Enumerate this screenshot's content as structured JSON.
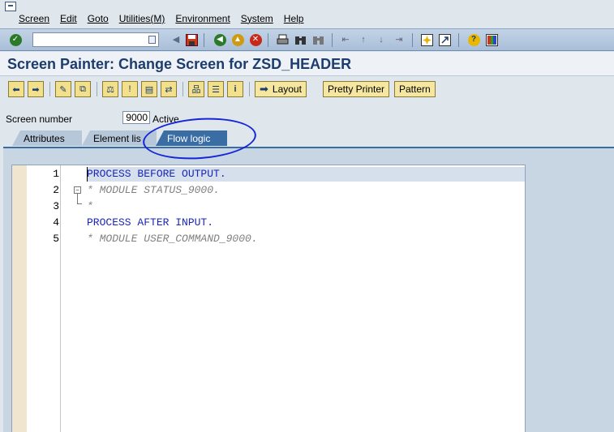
{
  "menubar": {
    "items": [
      "Screen",
      "Edit",
      "Goto",
      "Utilities(M)",
      "Environment",
      "System",
      "Help"
    ]
  },
  "stdbar": {
    "command_value": ""
  },
  "title": "Screen Painter: Change Screen for ZSD_HEADER",
  "apptoolbar": {
    "layout_label": "Layout",
    "pretty_printer_label": "Pretty Printer",
    "pattern_label": "Pattern"
  },
  "screen": {
    "label": "Screen number",
    "number": "9000",
    "status": "Active"
  },
  "tabs": [
    {
      "label": "Attributes"
    },
    {
      "label": "Element lis"
    },
    {
      "label": "Flow logic"
    }
  ],
  "editor": {
    "line_numbers": [
      "1",
      "2",
      "3",
      "4",
      "5"
    ],
    "lines": [
      "PROCESS BEFORE OUTPUT.",
      "* MODULE STATUS_9000.",
      "*",
      "PROCESS AFTER INPUT.",
      "* MODULE USER_COMMAND_9000."
    ]
  },
  "colors": {
    "keyword": "#1a26b8",
    "comment": "#808080",
    "title": "#1d3c6e",
    "active_tab": "#3a6da4",
    "annotation_circle": "#1525d8"
  }
}
